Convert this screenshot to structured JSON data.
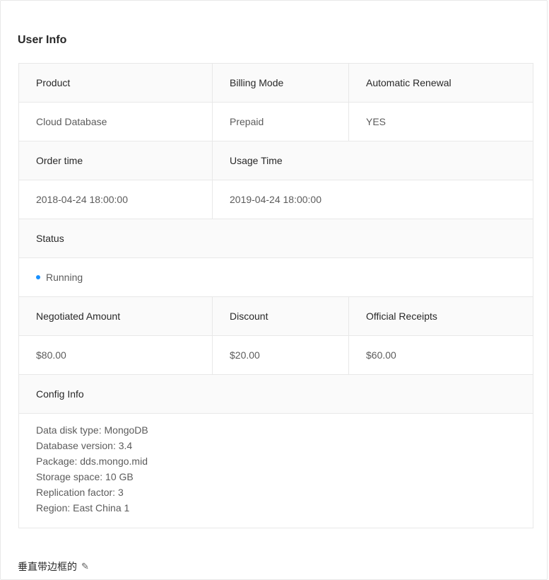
{
  "title": "User Info",
  "row1": {
    "labels": [
      "Product",
      "Billing Mode",
      "Automatic Renewal"
    ],
    "values": [
      "Cloud Database",
      "Prepaid",
      "YES"
    ]
  },
  "row2": {
    "labels": [
      "Order time",
      "Usage Time"
    ],
    "values": [
      "2018-04-24 18:00:00",
      "2019-04-24 18:00:00"
    ]
  },
  "status": {
    "label": "Status",
    "value": "Running",
    "color": "#1890ff"
  },
  "row3": {
    "labels": [
      "Negotiated Amount",
      "Discount",
      "Official Receipts"
    ],
    "values": [
      "$80.00",
      "$20.00",
      "$60.00"
    ]
  },
  "config": {
    "label": "Config Info",
    "lines": [
      "Data disk type: MongoDB",
      "Database version: 3.4",
      "Package: dds.mongo.mid",
      "Storage space: 10 GB",
      "Replication factor: 3",
      "Region: East China 1"
    ]
  },
  "footer": {
    "text": "垂直带边框的",
    "icon": "edit-icon"
  }
}
